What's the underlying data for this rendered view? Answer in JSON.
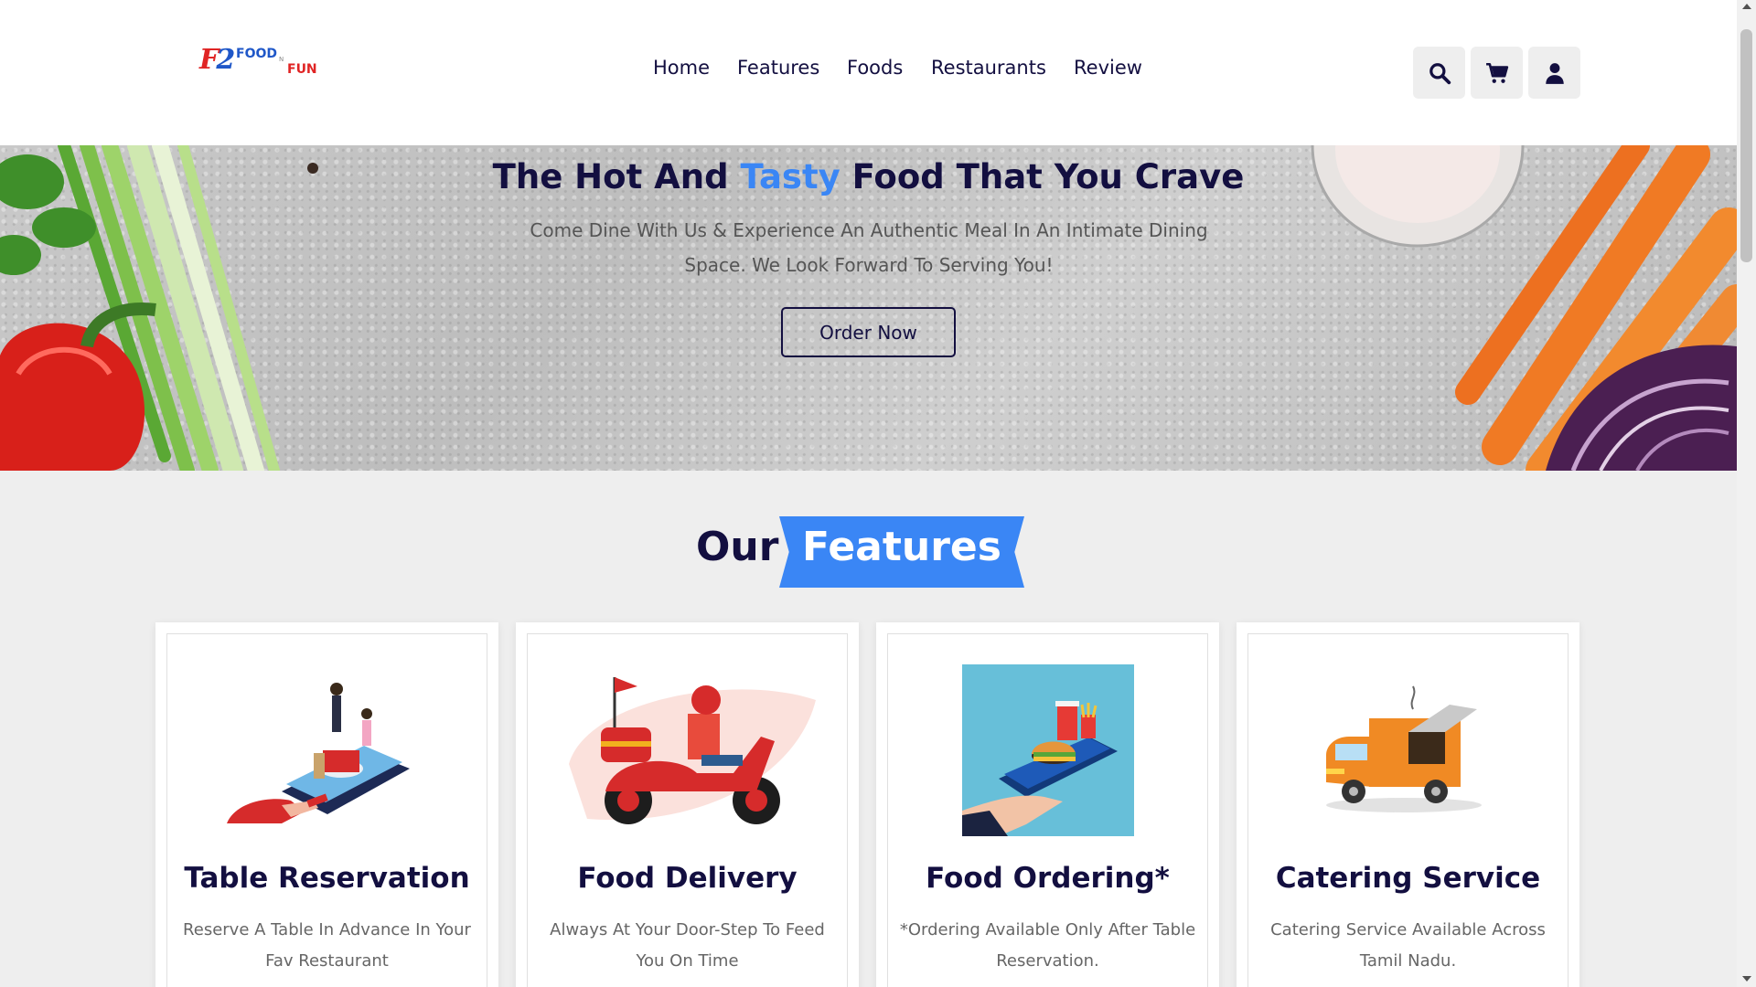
{
  "brand": {
    "logo_mark": "F2",
    "logo_word_top": "FOOD",
    "logo_word_mid": "N",
    "logo_word_bottom": "FUN",
    "primary_color": "#130f40",
    "accent_color": "#3a86f5"
  },
  "nav": {
    "items": [
      "Home",
      "Features",
      "Foods",
      "Restaurants",
      "Review"
    ]
  },
  "header_icons": [
    "search-icon",
    "cart-icon",
    "user-icon"
  ],
  "hero": {
    "title_pre": "The Hot And ",
    "title_highlight": "Tasty",
    "title_post": " Food That You Crave",
    "subtitle": "Come Dine With Us & Experience An Authentic Meal In An Intimate Dining Space. We Look Forward To Serving You!",
    "cta": "Order Now"
  },
  "features": {
    "heading_plain": "Our",
    "heading_tag": "Features",
    "cards": [
      {
        "title": "Table Reservation",
        "desc": "Reserve A Table In Advance In Your Fav Restaurant",
        "icon": "table-reservation-illustration"
      },
      {
        "title": "Food Delivery",
        "desc": "Always At Your Door-Step To Feed You On Time",
        "icon": "delivery-scooter-illustration"
      },
      {
        "title": "Food Ordering*",
        "desc": "*Ordering Available Only After Table Reservation.",
        "icon": "phone-burger-illustration"
      },
      {
        "title": "Catering Service",
        "desc": "Catering Service Available Across Tamil Nadu.",
        "icon": "food-truck-illustration"
      }
    ]
  }
}
